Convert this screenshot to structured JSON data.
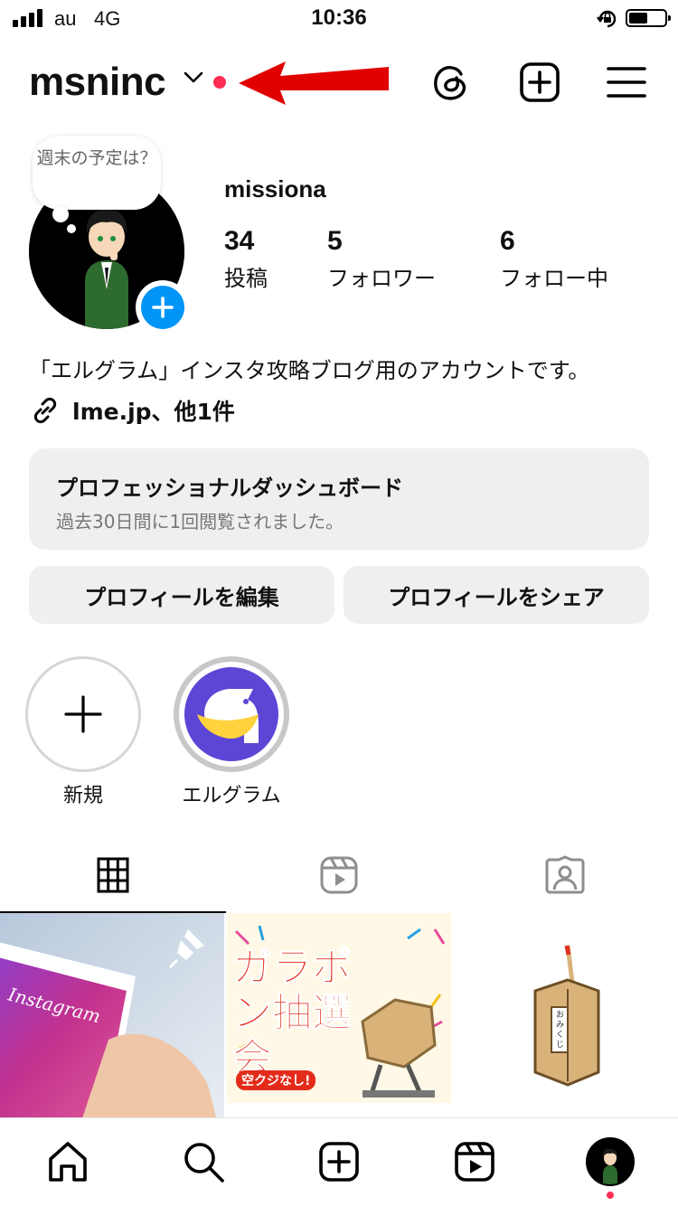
{
  "status_bar": {
    "carrier": "au",
    "network": "4G",
    "time": "10:36"
  },
  "header": {
    "username": "msninc"
  },
  "profile": {
    "note": "週末の予定は？",
    "display_name": "missiona",
    "stats": [
      {
        "value": "34",
        "label": "投稿"
      },
      {
        "value": "5",
        "label": "フォロワー"
      },
      {
        "value": "6",
        "label": "フォロー中"
      }
    ],
    "bio": "「エルグラム」インスタ攻略ブログ用のアカウントです。",
    "link": "lme.jp、他1件"
  },
  "dashboard": {
    "title": "プロフェッショナルダッシュボード",
    "subtitle": "過去30日間に1回閲覧されました。"
  },
  "buttons": {
    "edit": "プロフィールを編集",
    "share": "プロフィールをシェア"
  },
  "highlights": [
    {
      "label": "新規"
    },
    {
      "label": "エルグラム"
    }
  ],
  "posts": [
    {
      "caption": "Instagram"
    },
    {
      "caption": "ガラポン抽選会",
      "sub": "空クジなし!"
    },
    {
      "caption": "おみくじ"
    }
  ],
  "colors": {
    "accent_blue": "#0095f6",
    "notification_red": "#ff2d55",
    "arrow_red": "#e00000",
    "highlight_purple": "#5c46d6"
  }
}
